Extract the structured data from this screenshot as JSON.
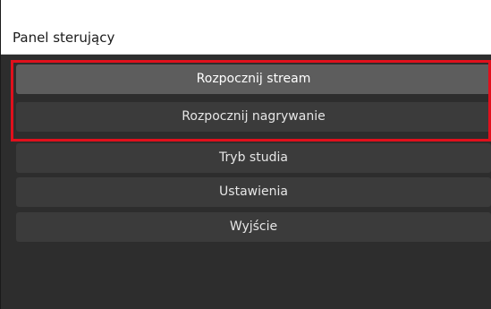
{
  "panel": {
    "title": "Panel sterujący"
  },
  "buttons": [
    {
      "label": "Rozpocznij stream"
    },
    {
      "label": "Rozpocznij nagrywanie"
    },
    {
      "label": "Tryb studia"
    },
    {
      "label": "Ustawienia"
    },
    {
      "label": "Wyjście"
    }
  ],
  "colors": {
    "panel_bg": "#2d2d2d",
    "button_bg": "#3b3b3b",
    "button_hover_bg": "#5d5d5d",
    "highlight": "#e0101c",
    "title_bar_bg": "#ffffff"
  }
}
